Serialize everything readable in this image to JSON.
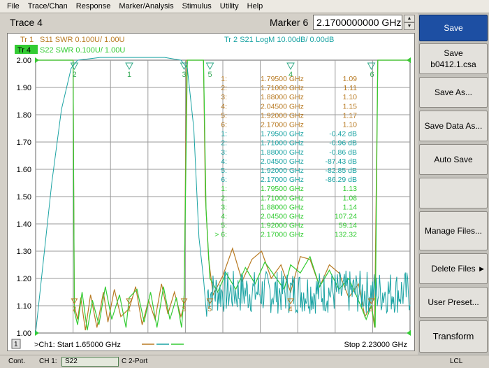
{
  "menubar": {
    "items": [
      "File",
      "Trace/Chan",
      "Response",
      "Marker/Analysis",
      "Stimulus",
      "Utility",
      "Help"
    ]
  },
  "header": {
    "trace_title": "Trace 4",
    "marker_label": "Marker 6",
    "marker_value": "2.1700000000 GHz"
  },
  "softkeys": {
    "save": "Save",
    "save_file_line1": "Save",
    "save_file_line2": "b0412.1.csa",
    "save_as": "Save As...",
    "save_data_as": "Save Data As...",
    "auto_save": "Auto Save",
    "blank": "",
    "manage_files": "Manage Files...",
    "delete_files": "Delete Files",
    "user_preset": "User Preset...",
    "transform": "Transform"
  },
  "status": {
    "cont": "Cont.",
    "ch": "CH 1:",
    "param": "S22",
    "c_port": "C  2-Port",
    "lcl": "LCL"
  },
  "colors": {
    "tr1": "#b87a22",
    "tr2": "#1aa3a3",
    "tr4": "#33cc33",
    "tr4_badge": "#33cc33",
    "grid": "#9a9a9a",
    "active_softkey": "#1d4fa3"
  },
  "chart_data": {
    "type": "line",
    "x_range_ghz": [
      1.65,
      2.23
    ],
    "ylim": [
      1.0,
      2.0
    ],
    "y_ticks": [
      "2.00",
      "1.90",
      "1.80",
      "1.70",
      "1.60",
      "1.50",
      "1.40",
      "1.30",
      "1.20",
      "1.10",
      "1.00"
    ],
    "grid": true,
    "channel_label": ">Ch1: Start  1.65000 GHz",
    "stop_label": "Stop  2.23000 GHz",
    "channel_number": "1",
    "traces": [
      {
        "id": "tr1",
        "badge": "Tr  1",
        "text": "S11  SWR  0.100U/   1.00U",
        "color": "#b87a22"
      },
      {
        "id": "tr4",
        "badge": "Tr  4",
        "text": "S22  SWR  0.100U/   1.00U",
        "color": "#33cc33",
        "active": true
      },
      {
        "id": "tr2",
        "badge": "",
        "text": "Tr  2   S21  LogM  10.00dB/   0.00dB",
        "color": "#1aa3a3"
      }
    ],
    "marker_table": [
      {
        "n": "1:",
        "freq": "1.79500 GHz",
        "val": "1.09",
        "color": "#b87a22"
      },
      {
        "n": "2:",
        "freq": "1.71000 GHz",
        "val": "1.11",
        "color": "#b87a22"
      },
      {
        "n": "3:",
        "freq": "1.88000 GHz",
        "val": "1.10",
        "color": "#b87a22"
      },
      {
        "n": "4:",
        "freq": "2.04500 GHz",
        "val": "1.15",
        "color": "#b87a22"
      },
      {
        "n": "5:",
        "freq": "1.92000 GHz",
        "val": "1.17",
        "color": "#b87a22"
      },
      {
        "n": "6:",
        "freq": "2.17000 GHz",
        "val": "1.10",
        "color": "#b87a22"
      },
      {
        "n": "1:",
        "freq": "1.79500 GHz",
        "val": "-0.42  dB",
        "color": "#1aa3a3"
      },
      {
        "n": "2:",
        "freq": "1.71000 GHz",
        "val": "-0.96  dB",
        "color": "#1aa3a3"
      },
      {
        "n": "3:",
        "freq": "1.88000 GHz",
        "val": "-0.86  dB",
        "color": "#1aa3a3"
      },
      {
        "n": "4:",
        "freq": "2.04500 GHz",
        "val": "-87.43  dB",
        "color": "#1aa3a3"
      },
      {
        "n": "5:",
        "freq": "1.92000 GHz",
        "val": "-82.85  dB",
        "color": "#1aa3a3"
      },
      {
        "n": "6:",
        "freq": "2.17000 GHz",
        "val": "-86.29  dB",
        "color": "#1aa3a3"
      },
      {
        "n": "1:",
        "freq": "1.79500 GHz",
        "val": "1.13",
        "color": "#33cc33"
      },
      {
        "n": "2:",
        "freq": "1.71000 GHz",
        "val": "1.08",
        "color": "#33cc33"
      },
      {
        "n": "3:",
        "freq": "1.88000 GHz",
        "val": "1.14",
        "color": "#33cc33"
      },
      {
        "n": "4:",
        "freq": "2.04500 GHz",
        "val": "107.24",
        "color": "#33cc33"
      },
      {
        "n": "5:",
        "freq": "1.92000 GHz",
        "val": "59.14",
        "color": "#33cc33"
      },
      {
        "n": "> 6:",
        "freq": "2.17000 GHz",
        "val": "132.32",
        "color": "#33cc33"
      }
    ],
    "markers": [
      {
        "label": "1",
        "freq": 1.795
      },
      {
        "label": "2",
        "freq": 1.71
      },
      {
        "label": "3",
        "freq": 1.88
      },
      {
        "label": "4",
        "freq": 2.045
      },
      {
        "label": "5",
        "freq": 1.92
      },
      {
        "label": "6",
        "freq": 2.17
      }
    ],
    "series": [
      {
        "name": "S11",
        "color": "#b87a22",
        "points": [
          [
            1.65,
            2.0
          ],
          [
            1.708,
            2.0
          ],
          [
            1.71,
            1.1
          ],
          [
            1.715,
            1.05
          ],
          [
            1.72,
            1.13
          ],
          [
            1.727,
            1.01
          ],
          [
            1.735,
            1.14
          ],
          [
            1.745,
            1.02
          ],
          [
            1.755,
            1.15
          ],
          [
            1.762,
            1.04
          ],
          [
            1.772,
            1.16
          ],
          [
            1.782,
            1.06
          ],
          [
            1.795,
            1.09
          ],
          [
            1.805,
            1.17
          ],
          [
            1.815,
            1.03
          ],
          [
            1.825,
            1.12
          ],
          [
            1.835,
            1.05
          ],
          [
            1.845,
            1.18
          ],
          [
            1.855,
            1.07
          ],
          [
            1.865,
            1.15
          ],
          [
            1.875,
            1.06
          ],
          [
            1.88,
            1.1
          ],
          [
            1.884,
            2.0
          ],
          [
            1.91,
            2.0
          ],
          [
            1.913,
            1.5
          ],
          [
            1.918,
            1.27
          ],
          [
            1.925,
            1.14
          ],
          [
            1.94,
            1.21
          ],
          [
            1.955,
            1.31
          ],
          [
            1.97,
            1.19
          ],
          [
            1.985,
            1.27
          ],
          [
            2.0,
            1.3
          ],
          [
            2.015,
            1.2
          ],
          [
            2.03,
            1.25
          ],
          [
            2.045,
            1.15
          ],
          [
            2.06,
            1.28
          ],
          [
            2.075,
            1.27
          ],
          [
            2.09,
            1.17
          ],
          [
            2.105,
            1.25
          ],
          [
            2.12,
            1.22
          ],
          [
            2.135,
            1.13
          ],
          [
            2.15,
            1.18
          ],
          [
            2.16,
            1.06
          ],
          [
            2.17,
            1.1
          ],
          [
            2.175,
            1.02
          ],
          [
            2.18,
            2.0
          ],
          [
            2.23,
            2.0
          ]
        ]
      },
      {
        "name": "S22",
        "color": "#33cc33",
        "points": [
          [
            1.65,
            2.0
          ],
          [
            1.708,
            2.0
          ],
          [
            1.71,
            1.08
          ],
          [
            1.715,
            1.03
          ],
          [
            1.722,
            1.15
          ],
          [
            1.73,
            1.01
          ],
          [
            1.738,
            1.12
          ],
          [
            1.748,
            1.03
          ],
          [
            1.758,
            1.17
          ],
          [
            1.768,
            1.05
          ],
          [
            1.78,
            1.14
          ],
          [
            1.79,
            1.02
          ],
          [
            1.795,
            1.13
          ],
          [
            1.807,
            1.16
          ],
          [
            1.818,
            1.04
          ],
          [
            1.828,
            1.15
          ],
          [
            1.838,
            1.02
          ],
          [
            1.848,
            1.17
          ],
          [
            1.858,
            1.05
          ],
          [
            1.868,
            1.13
          ],
          [
            1.876,
            1.02
          ],
          [
            1.88,
            1.14
          ],
          [
            1.885,
            2.0
          ],
          [
            1.91,
            2.0
          ],
          [
            1.914,
            1.45
          ],
          [
            1.92,
            1.2
          ],
          [
            1.932,
            1.15
          ],
          [
            1.945,
            1.22
          ],
          [
            1.96,
            1.16
          ],
          [
            1.975,
            1.24
          ],
          [
            1.99,
            1.18
          ],
          [
            2.005,
            1.26
          ],
          [
            2.02,
            1.21
          ],
          [
            2.035,
            1.16
          ],
          [
            2.045,
            1.25
          ],
          [
            2.06,
            1.22
          ],
          [
            2.075,
            1.28
          ],
          [
            2.09,
            1.17
          ],
          [
            2.105,
            1.23
          ],
          [
            2.12,
            1.16
          ],
          [
            2.135,
            1.2
          ],
          [
            2.15,
            1.12
          ],
          [
            2.162,
            1.05
          ],
          [
            2.17,
            1.1
          ],
          [
            2.176,
            1.02
          ],
          [
            2.18,
            2.0
          ],
          [
            2.23,
            2.0
          ]
        ]
      },
      {
        "name": "S21",
        "color": "#1aa3a3",
        "points": [
          [
            1.65,
            1.0
          ],
          [
            1.66,
            1.22
          ],
          [
            1.675,
            1.55
          ],
          [
            1.69,
            1.82
          ],
          [
            1.705,
            1.97
          ],
          [
            1.715,
            2.0
          ],
          [
            1.75,
            2.01
          ],
          [
            1.8,
            2.01
          ],
          [
            1.85,
            2.01
          ],
          [
            1.875,
            2.0
          ],
          [
            1.885,
            1.97
          ],
          [
            1.895,
            1.75
          ],
          [
            1.903,
            1.35
          ],
          [
            1.91,
            1.2
          ],
          [
            1.915,
            1.06
          ]
        ],
        "noise_from_ghz": 1.915,
        "noise_to_ghz": 2.23,
        "noise_center": 1.15,
        "noise_amplitude": 0.08
      }
    ]
  }
}
